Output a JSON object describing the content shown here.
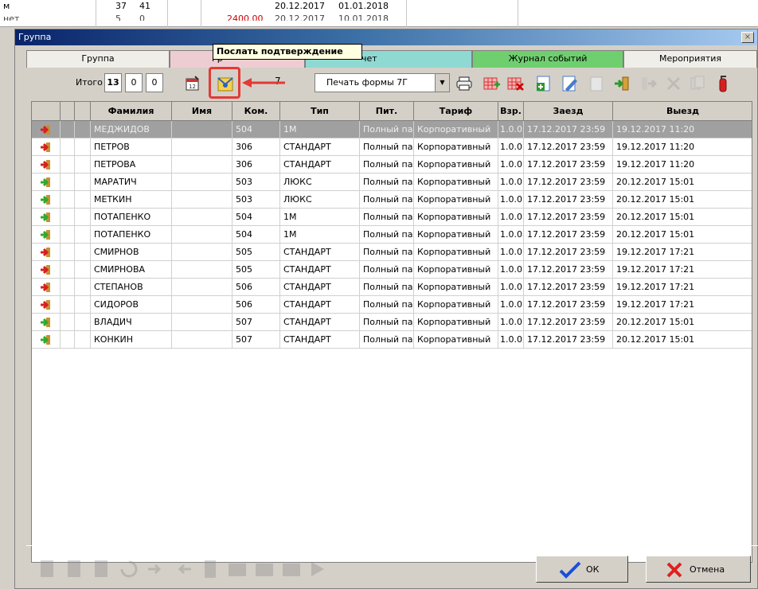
{
  "background": {
    "row1": {
      "col_a": "м",
      "n1": "37",
      "n2": "41",
      "d1": "20.12.2017",
      "d2": "01.01.2018"
    },
    "row2": {
      "col_a": "нет",
      "n1": "5",
      "n2": "0",
      "amount": "2400.00",
      "d1": "20.12.2017",
      "d2": "10.01.2018"
    }
  },
  "dialog": {
    "title": "Группа",
    "close_glyph": "×"
  },
  "tabs": [
    {
      "label": "Группа"
    },
    {
      "label": "Гр"
    },
    {
      "label": "чет"
    },
    {
      "label": "Журнал событий"
    },
    {
      "label": "Мероприятия"
    }
  ],
  "toolbar": {
    "itogo_label": "Итого",
    "count_total": "13",
    "count_2": "0",
    "count_3": "0",
    "tooltip": "Послать подтверждение",
    "print_select": "Печать формы 7Г",
    "icons": [
      "calendar-icon",
      "send-confirmation-icon",
      "printer-icon",
      "grid-add-icon",
      "grid-delete-icon",
      "add-document-icon",
      "edit-document-icon",
      "blank-icon",
      "checkin-icon",
      "checkout-icon",
      "cancel-icon",
      "copy-icon",
      "fire-extinguisher-icon"
    ]
  },
  "colors": {
    "checked_in": "#2eaa2e",
    "checked_out": "#d62020",
    "highlight": "#e53935"
  },
  "grid": {
    "columns": [
      "Фамилия",
      "Имя",
      "Ком.",
      "Тип",
      "Пит.",
      "Тариф",
      "Взр.",
      "Заезд",
      "Выезд"
    ],
    "rows": [
      {
        "status": "out",
        "surname": "МЕДЖИДОВ",
        "name": "",
        "room": "504",
        "type": "1М",
        "meal": "Полный па",
        "tariff": "Корпоративный",
        "adults": "1.0.0",
        "arrival": "17.12.2017 23:59",
        "departure": "19.12.2017 11:20",
        "selected": true
      },
      {
        "status": "out",
        "surname": "ПЕТРОВ",
        "name": "",
        "room": "306",
        "type": "СТАНДАРТ",
        "meal": "Полный па",
        "tariff": "Корпоративный",
        "adults": "1.0.0",
        "arrival": "17.12.2017 23:59",
        "departure": "19.12.2017 11:20"
      },
      {
        "status": "out",
        "surname": "ПЕТРОВА",
        "name": "",
        "room": "306",
        "type": "СТАНДАРТ",
        "meal": "Полный па",
        "tariff": "Корпоративный",
        "adults": "1.0.0",
        "arrival": "17.12.2017 23:59",
        "departure": "19.12.2017 11:20"
      },
      {
        "status": "in",
        "surname": "МАРАТИЧ",
        "name": "",
        "room": "503",
        "type": "ЛЮКС",
        "meal": "Полный па",
        "tariff": "Корпоративный",
        "adults": "1.0.0",
        "arrival": "17.12.2017 23:59",
        "departure": "20.12.2017 15:01"
      },
      {
        "status": "in",
        "surname": "МЕТКИН",
        "name": "",
        "room": "503",
        "type": "ЛЮКС",
        "meal": "Полный па",
        "tariff": "Корпоративный",
        "adults": "1.0.0",
        "arrival": "17.12.2017 23:59",
        "departure": "20.12.2017 15:01"
      },
      {
        "status": "in",
        "surname": "ПОТАПЕНКО",
        "name": "",
        "room": "504",
        "type": "1М",
        "meal": "Полный па",
        "tariff": "Корпоративный",
        "adults": "1.0.0",
        "arrival": "17.12.2017 23:59",
        "departure": "20.12.2017 15:01"
      },
      {
        "status": "in",
        "surname": "ПОТАПЕНКО",
        "name": "",
        "room": "504",
        "type": "1М",
        "meal": "Полный па",
        "tariff": "Корпоративный",
        "adults": "1.0.0",
        "arrival": "17.12.2017 23:59",
        "departure": "20.12.2017 15:01"
      },
      {
        "status": "out",
        "surname": "СМИРНОВ",
        "name": "",
        "room": "505",
        "type": "СТАНДАРТ",
        "meal": "Полный па",
        "tariff": "Корпоративный",
        "adults": "1.0.0",
        "arrival": "17.12.2017 23:59",
        "departure": "19.12.2017 17:21"
      },
      {
        "status": "out",
        "surname": "СМИРНОВА",
        "name": "",
        "room": "505",
        "type": "СТАНДАРТ",
        "meal": "Полный па",
        "tariff": "Корпоративный",
        "adults": "1.0.0",
        "arrival": "17.12.2017 23:59",
        "departure": "19.12.2017 17:21"
      },
      {
        "status": "out",
        "surname": "СТЕПАНОВ",
        "name": "",
        "room": "506",
        "type": "СТАНДАРТ",
        "meal": "Полный па",
        "tariff": "Корпоративный",
        "adults": "1.0.0",
        "arrival": "17.12.2017 23:59",
        "departure": "19.12.2017 17:21"
      },
      {
        "status": "out",
        "surname": "СИДОРОВ",
        "name": "",
        "room": "506",
        "type": "СТАНДАРТ",
        "meal": "Полный па",
        "tariff": "Корпоративный",
        "adults": "1.0.0",
        "arrival": "17.12.2017 23:59",
        "departure": "19.12.2017 17:21"
      },
      {
        "status": "in",
        "surname": "ВЛАДИЧ",
        "name": "",
        "room": "507",
        "type": "СТАНДАРТ",
        "meal": "Полный па",
        "tariff": "Корпоративный",
        "adults": "1.0.0",
        "arrival": "17.12.2017 23:59",
        "departure": "20.12.2017 15:01"
      },
      {
        "status": "in",
        "surname": "КОНКИН",
        "name": "",
        "room": "507",
        "type": "СТАНДАРТ",
        "meal": "Полный па",
        "tariff": "Корпоративный",
        "adults": "1.0.0",
        "arrival": "17.12.2017 23:59",
        "departure": "20.12.2017 15:01"
      }
    ]
  },
  "bottom": {
    "ok_label": "ОК",
    "cancel_label": "Отмена"
  }
}
